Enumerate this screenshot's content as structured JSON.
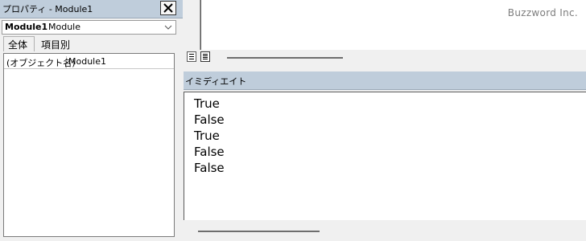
{
  "properties": {
    "title": "プロパティ - Module1",
    "object": {
      "name": "Module1",
      "type": "Module"
    },
    "tabs": [
      "全体",
      "項目別"
    ],
    "rows": [
      {
        "key": "(オブジェクト名)",
        "value": "Module1"
      }
    ]
  },
  "code_window": {
    "watermark": "Buzzword Inc."
  },
  "immediate": {
    "title": "イミディエイト",
    "lines": [
      "True",
      "False",
      "True",
      "False",
      "False"
    ]
  }
}
